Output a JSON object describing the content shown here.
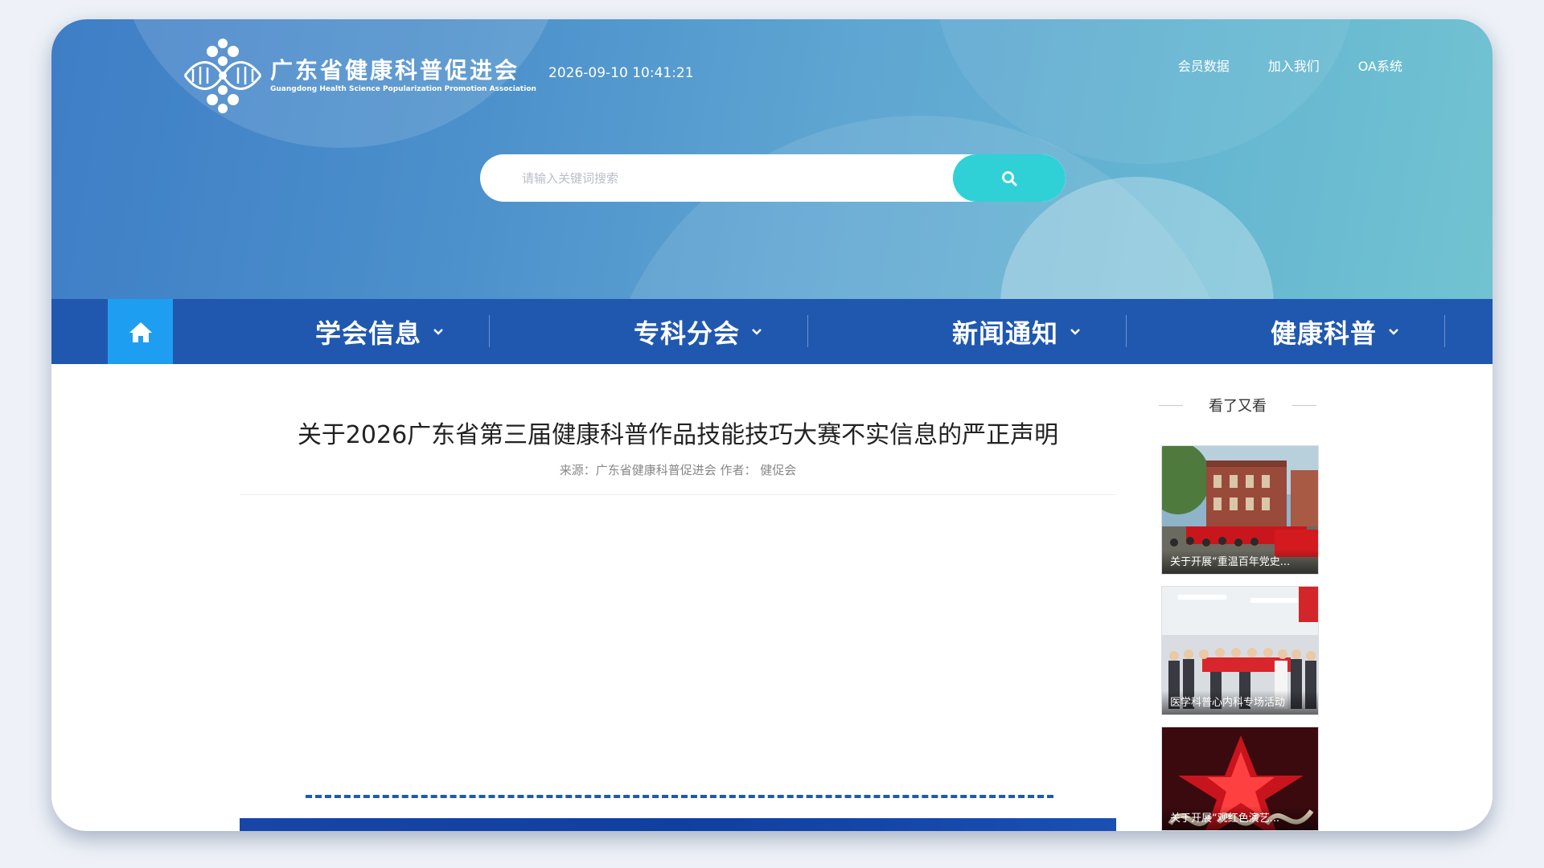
{
  "site": {
    "name_cn": "广东省健康科普促进会",
    "name_en": "Guangdong Health Science Popularization Promotion Association",
    "datetime": "2026-09-10 10:41:21"
  },
  "top_links": [
    {
      "label": "会员数据"
    },
    {
      "label": "加入我们"
    },
    {
      "label": "OA系统"
    }
  ],
  "search": {
    "placeholder": "请输入关键词搜索",
    "value": ""
  },
  "nav": {
    "home_icon": "home-icon",
    "items": [
      {
        "label": "学会信息"
      },
      {
        "label": "专科分会"
      },
      {
        "label": "新闻通知"
      },
      {
        "label": "健康科普"
      }
    ]
  },
  "article": {
    "title": "关于2026广东省第三届健康科普作品技能技巧大赛不实信息的严正声明",
    "meta": "来源：广东省健康科普促进会 作者： 健促会"
  },
  "sidebar": {
    "heading": "看了又看",
    "items": [
      {
        "caption": "关于开展“重温百年党史..."
      },
      {
        "caption": "医学科普心内科专场活动"
      },
      {
        "caption": "关于开展“观红色演艺..."
      }
    ]
  },
  "colors": {
    "nav_bg": "#2058b0",
    "home_bg": "#1e9ef1",
    "search_button": "#2fd1d6"
  }
}
